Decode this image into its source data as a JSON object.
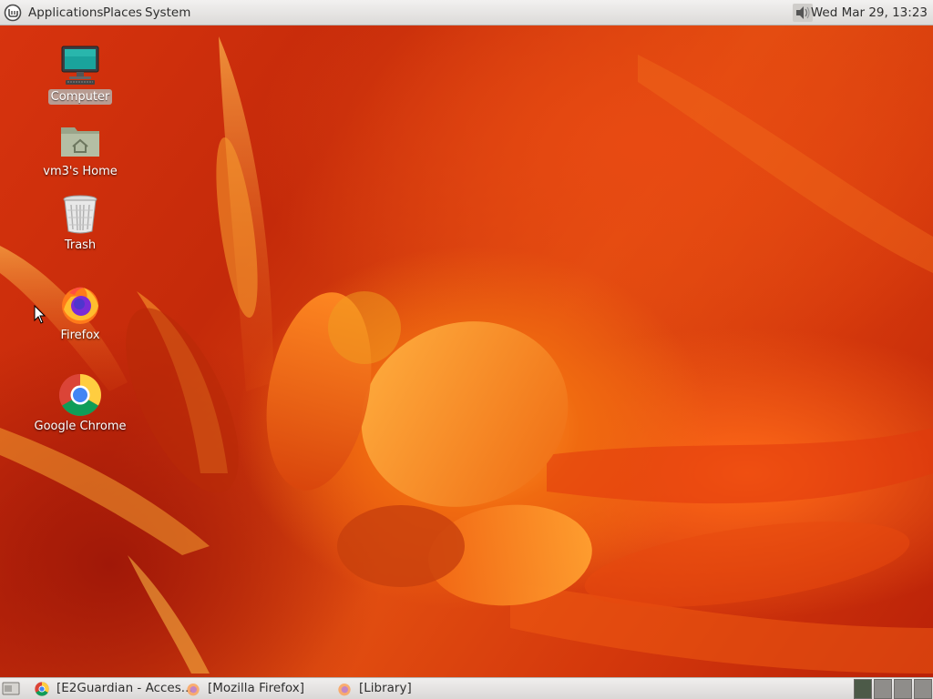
{
  "top_panel": {
    "menus": [
      "Applications",
      "Places",
      "System"
    ],
    "clock": "Wed Mar 29, 13:23",
    "volume_icon": "volume-icon",
    "logo_icon": "mint-logo-icon"
  },
  "desktop": {
    "icons": [
      {
        "label": "Computer",
        "icon": "computer-icon",
        "selected": true
      },
      {
        "label": "vm3's Home",
        "icon": "home-folder-icon",
        "selected": false
      },
      {
        "label": "Trash",
        "icon": "trash-icon",
        "selected": false
      },
      {
        "label": "Firefox",
        "icon": "firefox-icon",
        "selected": false
      },
      {
        "label": "Google Chrome",
        "icon": "chrome-icon",
        "selected": false
      }
    ]
  },
  "bottom_panel": {
    "show_desktop_icon": "show-desktop-icon",
    "tasks": [
      {
        "label": "[E2Guardian - Acces...",
        "icon": "chrome-icon"
      },
      {
        "label": "[Mozilla Firefox]",
        "icon": "firefox-icon"
      },
      {
        "label": "[Library]",
        "icon": "firefox-icon"
      }
    ],
    "workspaces": 4,
    "active_workspace": 1
  },
  "colors": {
    "panel_bg": "#e6e4e2",
    "wallpaper_main": "#d8340e",
    "wallpaper_highlight": "#ff9a2a"
  }
}
